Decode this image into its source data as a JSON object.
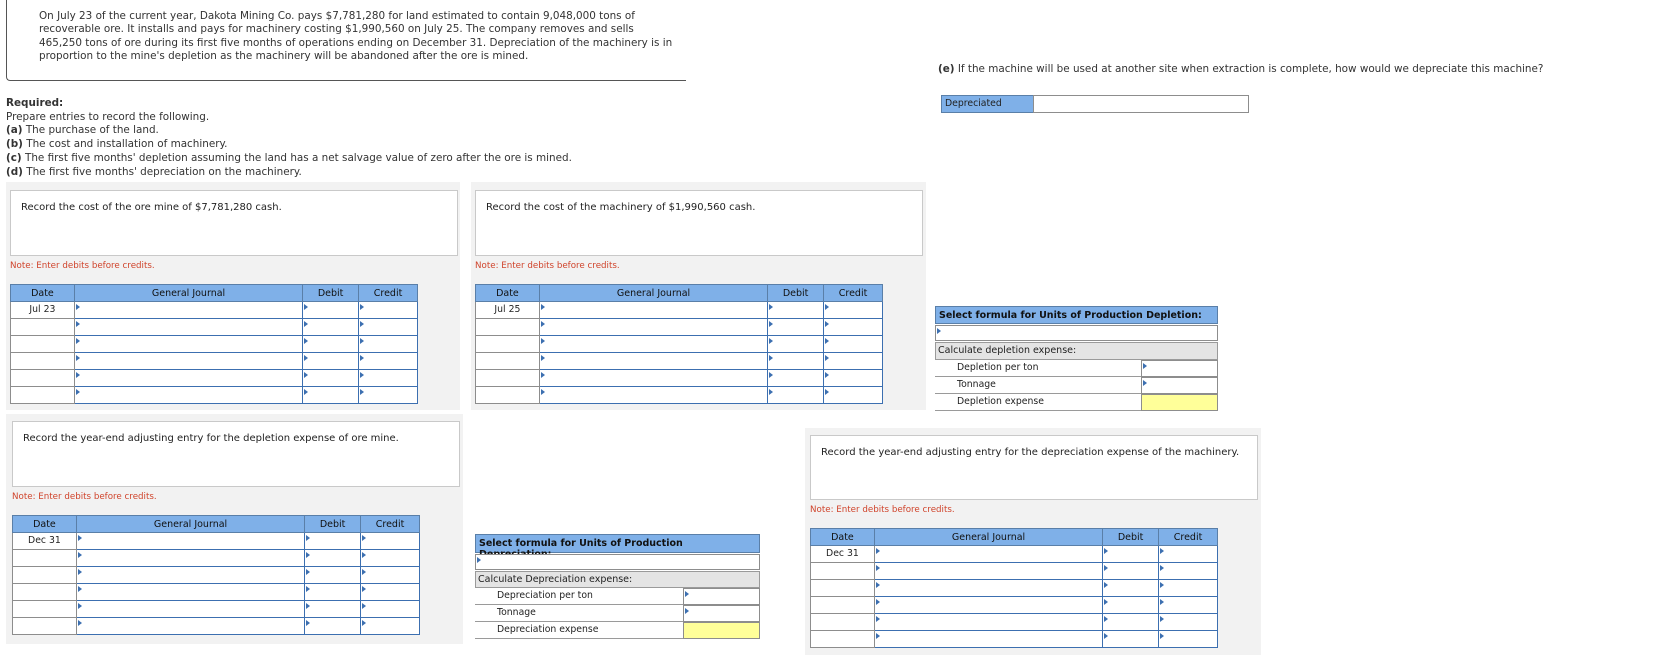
{
  "problem": {
    "text": "On July 23 of the current year, Dakota Mining Co. pays $7,781,280 for land estimated to contain 9,048,000 tons of recoverable ore. It installs and pays for machinery costing $1,990,560 on July 25. The company removes and sells 465,250 tons of ore during its first five months of operations ending on December 31. Depreciation of the machinery is in proportion to the mine's depletion as the machinery will be abandoned after the ore is mined."
  },
  "required": {
    "heading": "Required:",
    "intro": "Prepare entries to record the following.",
    "items": [
      {
        "tag": "(a)",
        "text": " The purchase of the land."
      },
      {
        "tag": "(b)",
        "text": " The cost and installation of machinery."
      },
      {
        "tag": "(c)",
        "text": " The first five months' depletion assuming the land has a net salvage value of zero after the ore is mined."
      },
      {
        "tag": "(d)",
        "text": " The first five months' depreciation on the machinery."
      }
    ]
  },
  "question_e": {
    "tag": "(e)",
    "text": " If the machine will be used at another site when extraction is complete, how would we depreciate this machine?",
    "select_value": "Depreciated"
  },
  "note_text": "Note: Enter debits before credits.",
  "journal_headers": [
    "Date",
    "General Journal",
    "Debit",
    "Credit"
  ],
  "panels": {
    "a": {
      "instruction": "Record the cost of the ore mine of $7,781,280 cash.",
      "date": "Jul 23"
    },
    "b": {
      "instruction": "Record the cost of the machinery of $1,990,560 cash.",
      "date": "Jul 25"
    },
    "c": {
      "instruction": "Record the year-end adjusting entry for the depletion expense of ore mine.",
      "date": "Dec 31"
    },
    "d": {
      "instruction": "Record the year-end adjusting entry for the depreciation expense of the machinery.",
      "date": "Dec 31"
    }
  },
  "depletion_formula": {
    "title": "Select formula for Units of Production Depletion:",
    "calc_label": "Calculate depletion expense:",
    "rows": [
      "Depletion per ton",
      "Tonnage",
      "Depletion expense"
    ]
  },
  "depreciation_formula": {
    "title": "Select formula for Units of Production Depreciation:",
    "calc_label": "Calculate Depreciation expense:",
    "rows": [
      "Depreciation per ton",
      "Tonnage",
      "Depreciation expense"
    ]
  }
}
